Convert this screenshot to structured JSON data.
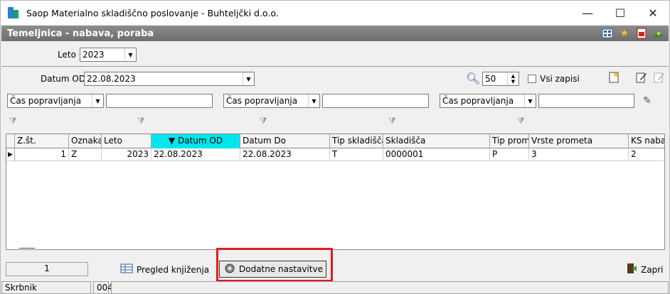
{
  "window": {
    "title": "Saop Materialno skladiščno poslovanje - Buhteljčki d.o.o.",
    "minimize": "—",
    "maximize": "☐",
    "close": "✕"
  },
  "module": {
    "title": "Temeljnica - nabava, poraba"
  },
  "filters": {
    "leto_label": "Leto",
    "leto_value": "2023",
    "datum_od_label": "Datum OD",
    "datum_od_value": "22.08.2023",
    "page_size": "50",
    "vsi_zapisi_label": "Vsi zapisi",
    "vsi_zapisi_checked": false,
    "field_1": "Čas popravljanja",
    "field_2": "Čas popravljanja",
    "field_3": "Čas popravljanja"
  },
  "grid": {
    "columns": [
      "Z.št.",
      "Oznaka",
      "Leto",
      "▼ Datum OD",
      "Datum Do",
      "Tip skladišča",
      "Skladišča",
      "Tip prometa",
      "Vrste prometa",
      "KS nabav"
    ],
    "rows": [
      [
        "1",
        "Z",
        "2023",
        "22.08.2023",
        "22.08.2023",
        "T",
        "0000001",
        "P",
        "3",
        "2"
      ]
    ]
  },
  "bottom": {
    "pregled_label": "Pregled knjiženja",
    "dodatne_label": "Dodatne nastavitve",
    "zapri_label": "Zapri",
    "record_count": "1"
  },
  "status_bar": {
    "field_label": "Skrbnik",
    "field_value": "004"
  },
  "colors": {
    "sorted_header": "#00e5ee",
    "highlight_border": "#e11b1b"
  }
}
